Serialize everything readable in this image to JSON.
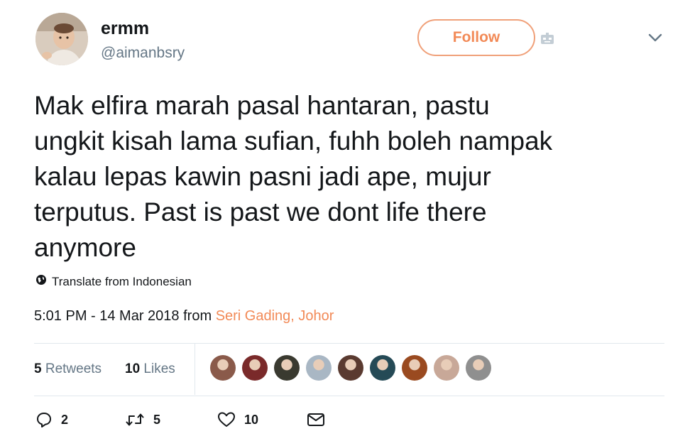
{
  "user": {
    "name": "ermm",
    "handle": "@aimanbsry"
  },
  "header": {
    "follow_label": "Follow",
    "bot_icon": "robot-icon",
    "menu_icon": "chevron-down-icon"
  },
  "tweet": {
    "text": "Mak elfira marah pasal hantaran, pastu\nungkit kisah lama sufian, fuhh boleh nampak\nkalau lepas kawin pasni jadi ape, mujur\nterputus. Past is past we dont life there\nanymore",
    "translate_label": "Translate from Indonesian",
    "timestamp": "5:01 PM - 14 Mar 2018",
    "from_label": "from",
    "location": "Seri Gading, Johor"
  },
  "stats": {
    "retweets_count": "5",
    "retweets_label": "Retweets",
    "likes_count": "10",
    "likes_label": "Likes"
  },
  "likers": [
    {
      "color": "#8a5a4a"
    },
    {
      "color": "#7a2a2a"
    },
    {
      "color": "#3a3a30"
    },
    {
      "color": "#a9b7c4"
    },
    {
      "color": "#5a3a30"
    },
    {
      "color": "#254a56"
    },
    {
      "color": "#9a4a20"
    },
    {
      "color": "#c8a898"
    },
    {
      "color": "#8f8f8f"
    }
  ],
  "actions": {
    "reply_count": "2",
    "retweet_count": "5",
    "like_count": "10"
  },
  "colors": {
    "accent": "#f28a57",
    "text": "#14171a",
    "muted": "#657786",
    "divider": "#e1e8ed"
  }
}
